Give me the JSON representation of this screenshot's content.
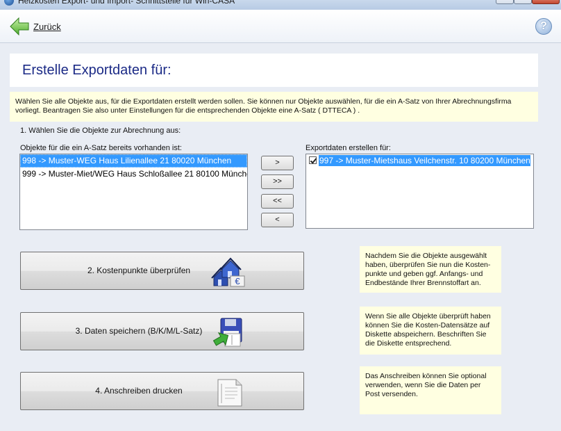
{
  "window": {
    "title": "Heizkosten Export- und Import- Schnittstelle für Win-CASA"
  },
  "toolbar": {
    "back_label": "Zurück",
    "help_label": "?"
  },
  "heading": "Erstelle Exportdaten für:",
  "info_text": "Wählen Sie alle Objekte aus, für die Exportdaten erstellt werden sollen. Sie können nur Objekte auswählen, für die ein A-Satz von Ihrer Abrechnungsfirma vorliegt. Beantragen Sie also unter Einstellungen für die entsprechenden Objekte eine A-Satz ( DTTECA ) .",
  "step1_label": "1. Wählen Sie die Objekte zur Abrechnung aus:",
  "available": {
    "label": "Objekte für die ein A-Satz bereits vorhanden ist:",
    "items": [
      {
        "text": "998 -> Muster-WEG Haus  Lilienallee 21   80020 München",
        "selected": true
      },
      {
        "text": "999 -> Muster-Miet/WEG Haus  Schloßallee 21   80100 München",
        "selected": false
      }
    ]
  },
  "move_buttons": {
    "add": ">",
    "add_all": ">>",
    "remove_all": "<<",
    "remove": "<"
  },
  "export": {
    "label": "Exportdaten erstellen für:",
    "items": [
      {
        "text": "997 -> Muster-Mietshaus  Veilchenstr. 10   80200 München",
        "checked": true,
        "selected": true
      }
    ]
  },
  "actions": [
    {
      "label": "2. Kostenpunkte überprüfen",
      "icon": "houses-euro-icon",
      "note": "Nachdem Sie die Objekte ausgewählt haben, überprüfen Sie nun die Kosten-punkte und geben ggf. Anfangs- und Endbestände Ihrer Brennstoffart an."
    },
    {
      "label": "3. Daten speichern (B/K/M/L-Satz)",
      "icon": "floppy-save-icon",
      "note": "Wenn Sie alle Objekte überprüft haben können Sie die Kosten-Datensätze auf Diskette abspeichern. Beschriften Sie die Diskette entsprechend."
    },
    {
      "label": "4. Anschreiben drucken",
      "icon": "letter-document-icon",
      "note": "Das Anschreiben können Sie optional verwenden, wenn Sie die Daten per Post versenden."
    }
  ]
}
